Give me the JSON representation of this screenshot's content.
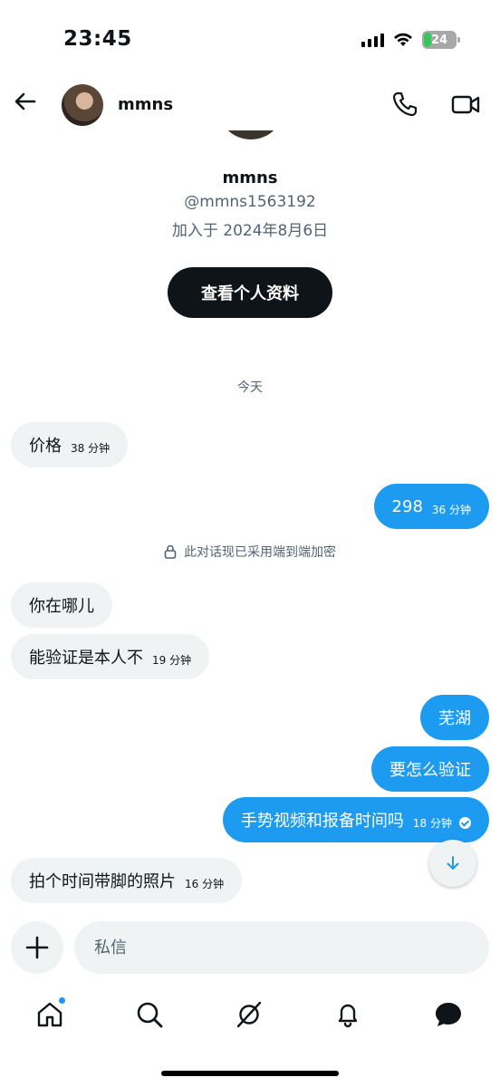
{
  "status_bar": {
    "time": "23:45",
    "battery": "24",
    "battery_level": 0.24,
    "icons": [
      "signal-icon",
      "wifi-icon",
      "battery-icon"
    ]
  },
  "header": {
    "name": "mmns",
    "icons": [
      "back-arrow-icon",
      "phone-icon",
      "video-camera-icon"
    ]
  },
  "profile": {
    "name": "mmns",
    "handle": "@mmns1563192",
    "joined": "加入于 2024年8月6日",
    "view_profile_label": "查看个人资料"
  },
  "date_separator": "今天",
  "encryption_note": "此对话现已采用端到端加密",
  "messages": [
    {
      "direction": "in",
      "text": "价格",
      "time": "38 分钟"
    },
    {
      "direction": "out",
      "text": "298",
      "time": "36 分钟"
    },
    {
      "direction": "in",
      "text": "你在哪儿",
      "time": ""
    },
    {
      "direction": "in",
      "text": "能验证是本人不",
      "time": "19 分钟"
    },
    {
      "direction": "out",
      "text": "芜湖",
      "time": ""
    },
    {
      "direction": "out",
      "text": "要怎么验证",
      "time": ""
    },
    {
      "direction": "out",
      "text": "手势视频和报备时间吗",
      "time": "18 分钟",
      "read": true
    },
    {
      "direction": "in",
      "text": "拍个时间带脚的照片",
      "time": "16 分钟"
    }
  ],
  "composer": {
    "placeholder": "私信"
  },
  "bottom_nav": {
    "items": [
      "home-icon",
      "search-icon",
      "grok-icon",
      "notifications-icon",
      "messages-icon"
    ],
    "accent": "#1d9bf0"
  },
  "colors": {
    "accent": "#1d9bf0",
    "incoming_bubble": "#eff3f4",
    "text": "#0f1419",
    "secondary_text": "#536471"
  }
}
